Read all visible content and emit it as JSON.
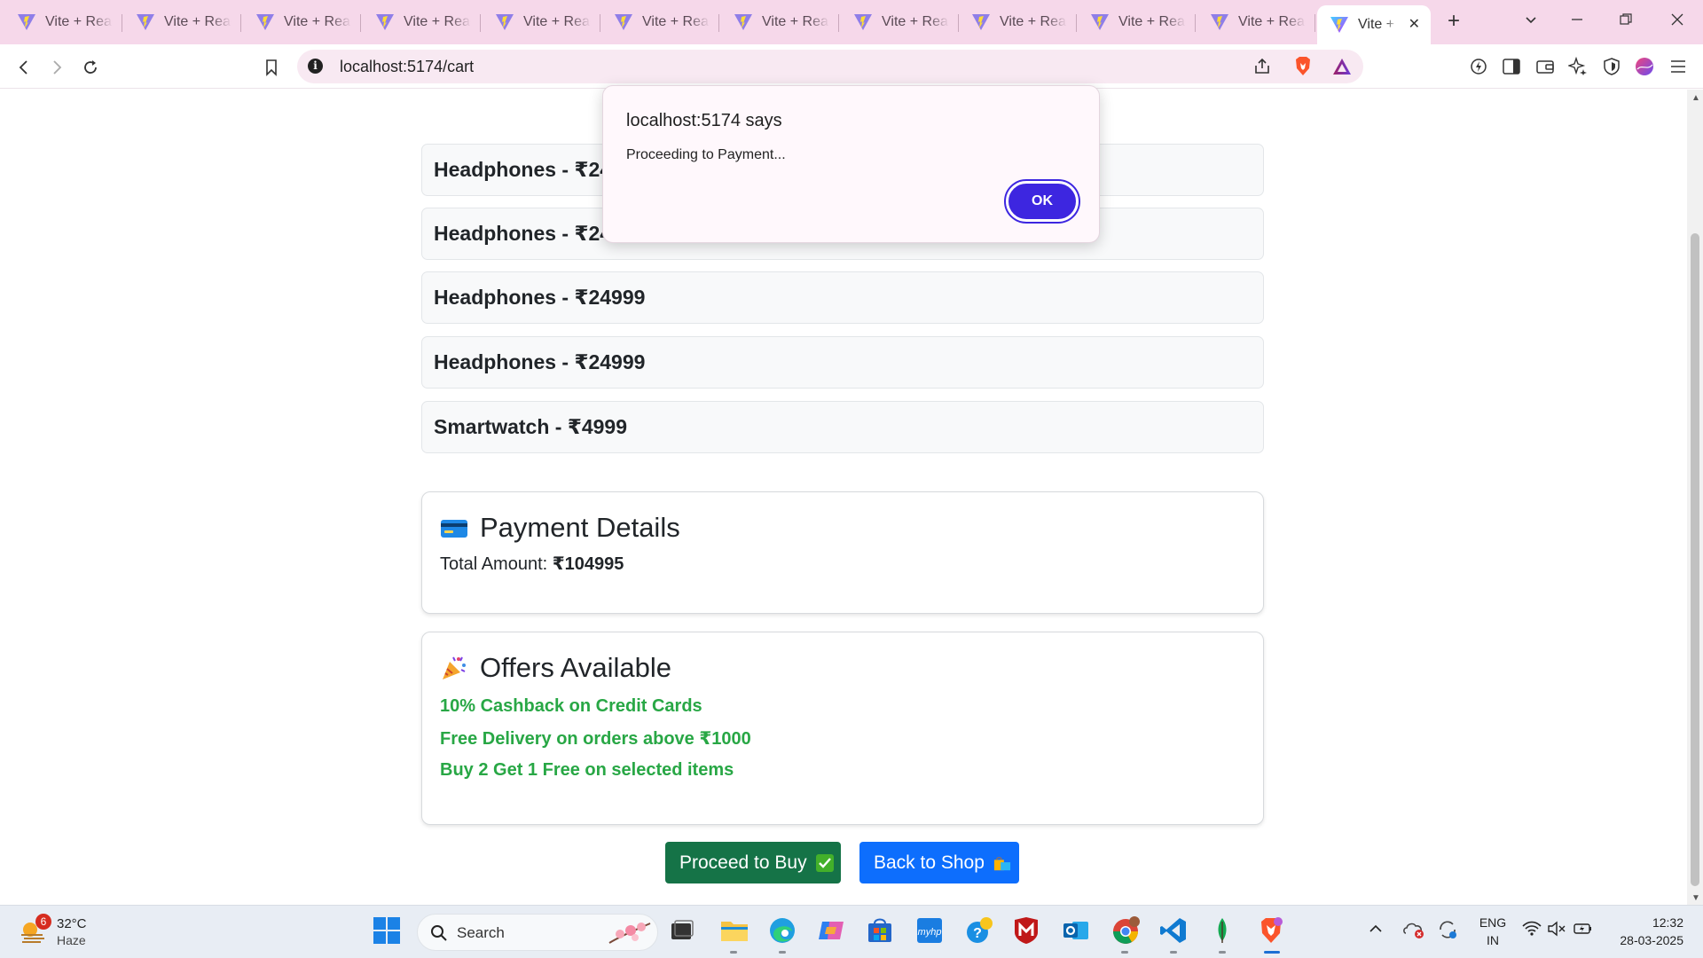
{
  "browser": {
    "tabs": [
      {
        "title": "Vite + React"
      },
      {
        "title": "Vite + React"
      },
      {
        "title": "Vite + React"
      },
      {
        "title": "Vite + React"
      },
      {
        "title": "Vite + React"
      },
      {
        "title": "Vite + React"
      },
      {
        "title": "Vite + React"
      },
      {
        "title": "Vite + React"
      },
      {
        "title": "Vite + React"
      },
      {
        "title": "Vite + React"
      },
      {
        "title": "Vite + React"
      }
    ],
    "active_tab": {
      "title": "Vite + React"
    },
    "url": "localhost:5174/cart",
    "new_tab_symbol": "+",
    "close_symbol": "✕"
  },
  "cart": {
    "items": [
      {
        "label": "Headphones - ₹24999"
      },
      {
        "label": "Headphones - ₹24999"
      },
      {
        "label": "Headphones - ₹24999"
      },
      {
        "label": "Headphones - ₹24999"
      },
      {
        "label": "Smartwatch - ₹4999"
      }
    ]
  },
  "payment": {
    "title": "Payment Details",
    "total_label": "Total Amount:",
    "total_value": "₹104995"
  },
  "offers": {
    "title": "Offers Available",
    "items": [
      {
        "text": "10% Cashback on Credit Cards"
      },
      {
        "text": "Free Delivery on orders above ₹1000"
      },
      {
        "text": "Buy 2 Get 1 Free on selected items"
      }
    ]
  },
  "buttons": {
    "buy": "Proceed to Buy",
    "shop": "Back to Shop"
  },
  "dialog": {
    "title": "localhost:5174 says",
    "message": "Proceeding to Payment...",
    "ok": "OK"
  },
  "taskbar": {
    "weather_badge": "6",
    "temperature": "32°C",
    "condition": "Haze",
    "search_placeholder": "Search",
    "lang_line1": "ENG",
    "lang_line2": "IN",
    "time": "12:32",
    "date": "28-03-2025"
  },
  "colors": {
    "tabstrip": "#f6d8ea",
    "offer_green": "#28a745",
    "buy_button": "#157347",
    "shop_button": "#0d6efd",
    "dialog_ok": "#3d26e0"
  }
}
